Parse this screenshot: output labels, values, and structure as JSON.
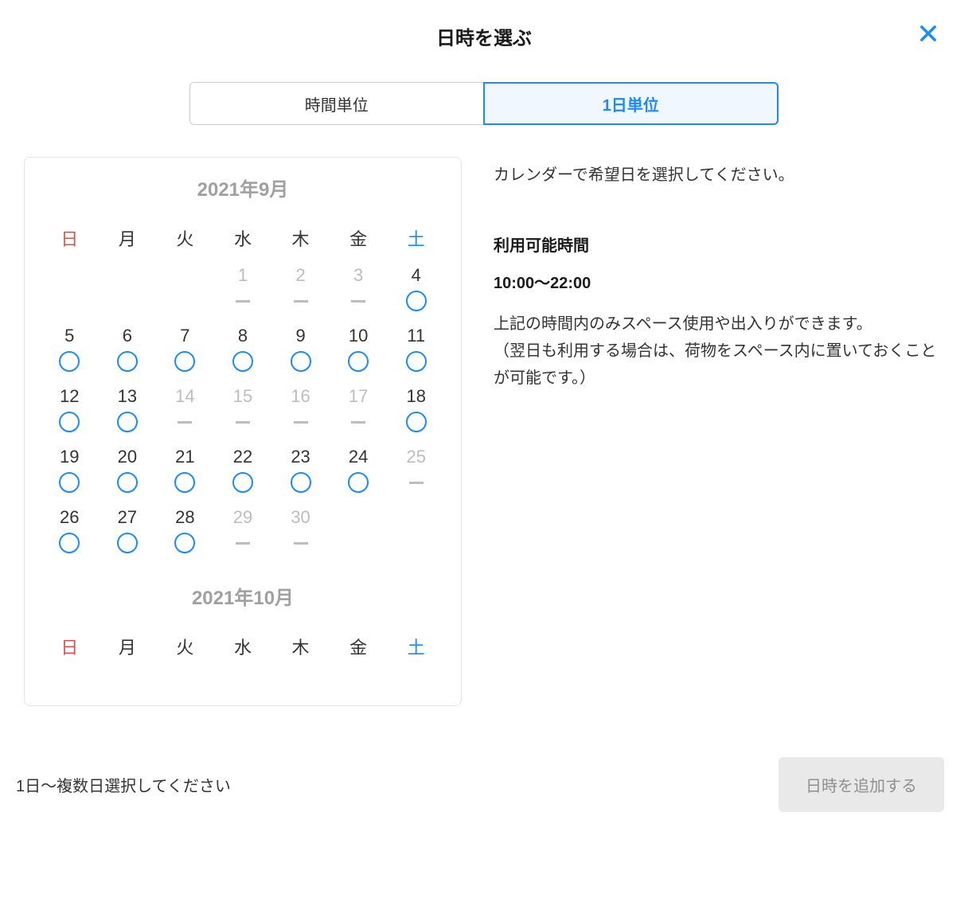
{
  "header": {
    "title": "日時を選ぶ"
  },
  "tabs": {
    "hour": "時間単位",
    "day": "1日単位",
    "active": "day"
  },
  "info": {
    "intro": "カレンダーで希望日を選択してください。",
    "available_heading": "利用可能時間",
    "hours": "10:00〜22:00",
    "desc1": "上記の時間内のみスペース使用や出入りができます。",
    "desc2": "（翌日も利用する場合は、荷物をスペース内に置いておくことが可能です。）"
  },
  "weekdays": [
    "日",
    "月",
    "火",
    "水",
    "木",
    "金",
    "土"
  ],
  "months": [
    {
      "label": "2021年9月",
      "weeks": [
        [
          null,
          null,
          null,
          {
            "d": "1",
            "s": "dash"
          },
          {
            "d": "2",
            "s": "dash"
          },
          {
            "d": "3",
            "s": "dash"
          },
          {
            "d": "4",
            "s": "circle"
          }
        ],
        [
          {
            "d": "5",
            "s": "circle"
          },
          {
            "d": "6",
            "s": "circle"
          },
          {
            "d": "7",
            "s": "circle"
          },
          {
            "d": "8",
            "s": "circle"
          },
          {
            "d": "9",
            "s": "circle"
          },
          {
            "d": "10",
            "s": "circle"
          },
          {
            "d": "11",
            "s": "circle"
          }
        ],
        [
          {
            "d": "12",
            "s": "circle"
          },
          {
            "d": "13",
            "s": "circle"
          },
          {
            "d": "14",
            "s": "dash"
          },
          {
            "d": "15",
            "s": "dash"
          },
          {
            "d": "16",
            "s": "dash"
          },
          {
            "d": "17",
            "s": "dash"
          },
          {
            "d": "18",
            "s": "circle"
          }
        ],
        [
          {
            "d": "19",
            "s": "circle"
          },
          {
            "d": "20",
            "s": "circle"
          },
          {
            "d": "21",
            "s": "circle"
          },
          {
            "d": "22",
            "s": "circle"
          },
          {
            "d": "23",
            "s": "circle"
          },
          {
            "d": "24",
            "s": "circle"
          },
          {
            "d": "25",
            "s": "dash"
          }
        ],
        [
          {
            "d": "26",
            "s": "circle"
          },
          {
            "d": "27",
            "s": "circle"
          },
          {
            "d": "28",
            "s": "circle"
          },
          {
            "d": "29",
            "s": "dash"
          },
          {
            "d": "30",
            "s": "dash"
          },
          null,
          null
        ]
      ]
    },
    {
      "label": "2021年10月",
      "weeks": []
    }
  ],
  "footer": {
    "hint": "1日〜複数日選択してください",
    "button": "日時を追加する"
  }
}
